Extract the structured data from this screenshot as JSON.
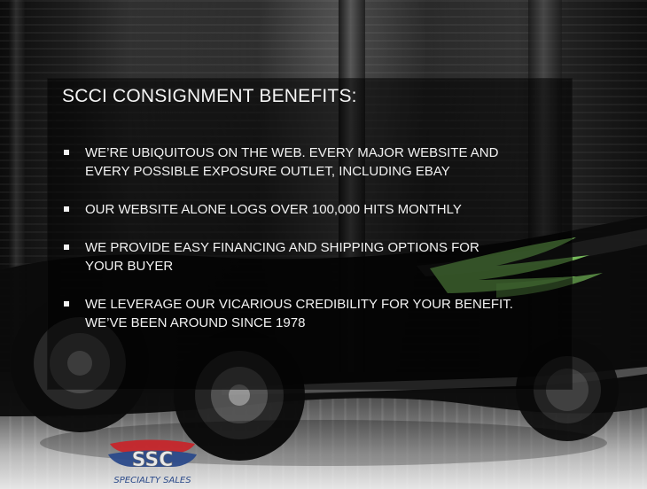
{
  "slide": {
    "title": "SCCI CONSIGNMENT BENEFITS:",
    "bullets": [
      {
        "text": "WE’RE UBIQUITOUS ON THE WEB. EVERY MAJOR WEBSITE AND\nEVERY POSSIBLE EXPOSURE OUTLET, INCLUDING EBAY"
      },
      {
        "text": "OUR WEBSITE ALONE LOGS OVER 100,000 HITS MONTHLY"
      },
      {
        "text": "WE PROVIDE EASY FINANCING AND SHIPPING OPTIONS FOR\nYOUR BUYER"
      },
      {
        "text": "WE LEVERAGE OUR VICARIOUS CREDIBILITY FOR YOUR BENEFIT.\nWE’VE BEEN AROUND SINCE 1978"
      }
    ],
    "logo": {
      "letters": "SSC",
      "tagline": "SPECIALTY SALES"
    }
  },
  "colors": {
    "text": "#f2f2f2",
    "accent_green": "#8ee36b",
    "car_body": "#0b0b0b",
    "logo_red": "#c6262b",
    "logo_blue": "#2b4a8a"
  }
}
